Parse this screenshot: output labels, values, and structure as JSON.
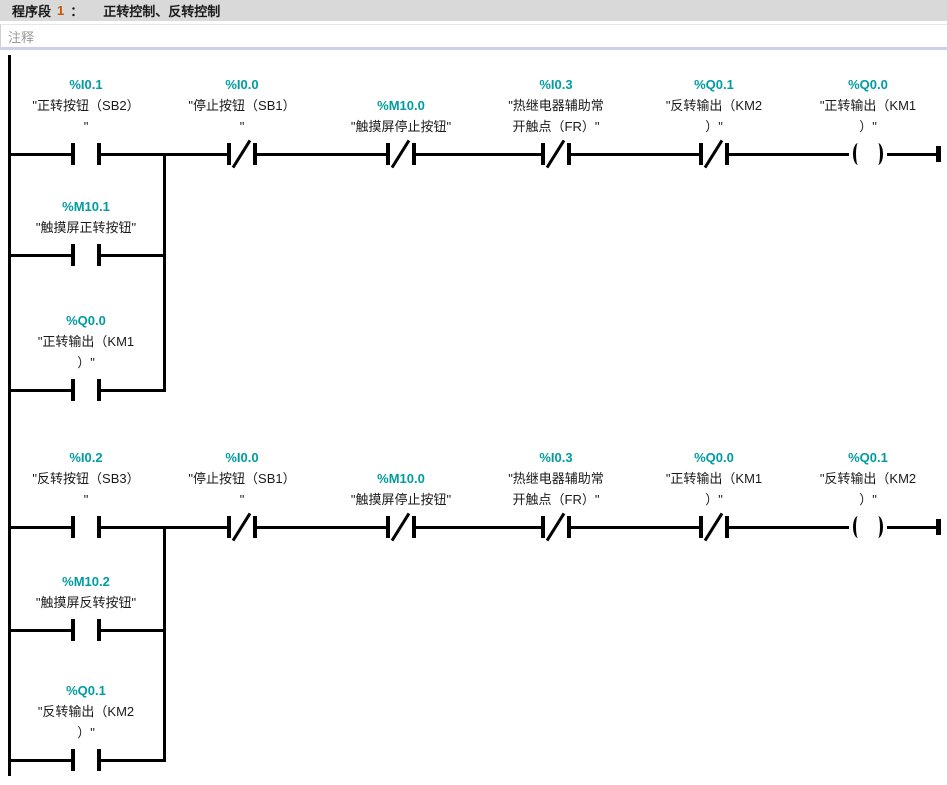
{
  "header": {
    "label_prefix": "程序段",
    "network_number": "1",
    "label_colon": "：",
    "title": "正转控制、反转控制"
  },
  "comment": {
    "placeholder": "注释"
  },
  "colors": {
    "operand": "#009CA1",
    "network_number": "#CC5500",
    "header_bg": "#D9D9D9",
    "separator": "#CDD0E8",
    "comment_text": "#9A9A9A",
    "wire": "#000000"
  },
  "ladder": {
    "rungs": [
      {
        "id": "rung-1",
        "elements": [
          {
            "kind": "contact_no",
            "address": "%I0.1",
            "lines": [
              "\"正转按钮（SB2）",
              "\""
            ]
          },
          {
            "kind": "contact_nc",
            "address": "%I0.0",
            "lines": [
              "\"停止按钮（SB1）",
              "\""
            ]
          },
          {
            "kind": "contact_nc",
            "address": "%M10.0",
            "lines": [
              "\"触摸屏停止按钮\""
            ]
          },
          {
            "kind": "contact_nc",
            "address": "%I0.3",
            "lines": [
              "\"热继电器辅助常",
              "开触点（FR）\""
            ]
          },
          {
            "kind": "contact_nc",
            "address": "%Q0.1",
            "lines": [
              "\"反转输出（KM2",
              "）\""
            ]
          },
          {
            "kind": "coil",
            "address": "%Q0.0",
            "lines": [
              "\"正转输出（KM1",
              "）\""
            ]
          }
        ],
        "branches": [
          {
            "kind": "contact_no",
            "address": "%M10.1",
            "lines": [
              "\"触摸屏正转按钮\""
            ]
          },
          {
            "kind": "contact_no",
            "address": "%Q0.0",
            "lines": [
              "\"正转输出（KM1",
              "）\""
            ]
          }
        ]
      },
      {
        "id": "rung-2",
        "elements": [
          {
            "kind": "contact_no",
            "address": "%I0.2",
            "lines": [
              "\"反转按钮（SB3）",
              "\""
            ]
          },
          {
            "kind": "contact_nc",
            "address": "%I0.0",
            "lines": [
              "\"停止按钮（SB1）",
              "\""
            ]
          },
          {
            "kind": "contact_nc",
            "address": "%M10.0",
            "lines": [
              "\"触摸屏停止按钮\""
            ]
          },
          {
            "kind": "contact_nc",
            "address": "%I0.3",
            "lines": [
              "\"热继电器辅助常",
              "开触点（FR）\""
            ]
          },
          {
            "kind": "contact_nc",
            "address": "%Q0.0",
            "lines": [
              "\"正转输出（KM1",
              "）\""
            ]
          },
          {
            "kind": "coil",
            "address": "%Q0.1",
            "lines": [
              "\"反转输出（KM2",
              "）\""
            ]
          }
        ],
        "branches": [
          {
            "kind": "contact_no",
            "address": "%M10.2",
            "lines": [
              "\"触摸屏反转按钮\""
            ]
          },
          {
            "kind": "contact_no",
            "address": "%Q0.1",
            "lines": [
              "\"反转输出（KM2",
              "）\""
            ]
          }
        ]
      }
    ]
  }
}
